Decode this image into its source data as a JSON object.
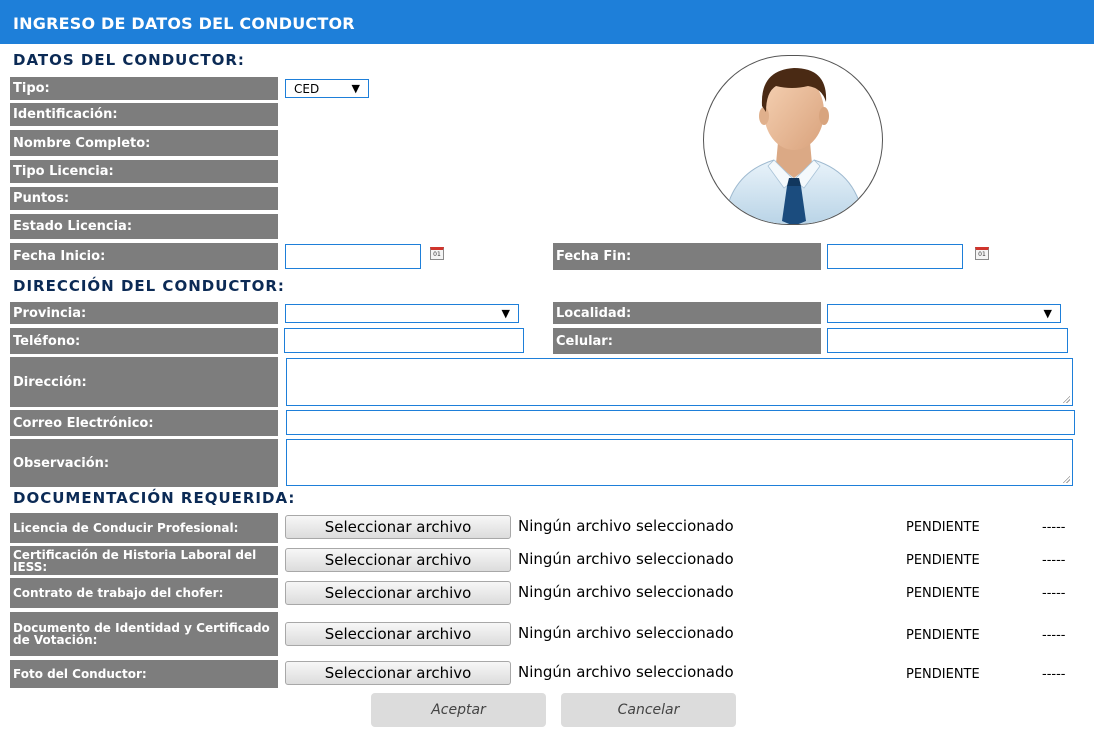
{
  "header": {
    "title": "INGRESO DE DATOS DEL CONDUCTOR"
  },
  "conductor": {
    "section_title": "DATOS DEL CONDUCTOR:",
    "tipo_label": "Tipo:",
    "tipo_value": "CED",
    "identificacion_label": "Identificación:",
    "nombre_label": "Nombre Completo:",
    "tipo_licencia_label": "Tipo Licencia:",
    "puntos_label": "Puntos:",
    "estado_licencia_label": "Estado Licencia:",
    "fecha_inicio_label": "Fecha Inicio:",
    "fecha_fin_label": "Fecha Fin:",
    "calendar_text": "01"
  },
  "direccion": {
    "section_title": "DIRECCIÓN DEL CONDUCTOR:",
    "provincia_label": "Provincia:",
    "localidad_label": "Localidad:",
    "telefono_label": "Teléfono:",
    "celular_label": "Celular:",
    "direccion_label": "Dirección:",
    "correo_label": "Correo Electrónico:",
    "observacion_label": "Observación:"
  },
  "documentacion": {
    "section_title": "DOCUMENTACIÓN REQUERIDA:",
    "button_label": "Seleccionar archivo",
    "no_file_text": "Ningún archivo seleccionado",
    "items": [
      {
        "label": "Licencia de Conducir Profesional:",
        "status": "PENDIENTE",
        "extra": "-----"
      },
      {
        "label": "Certificación de Historia Laboral del IESS:",
        "status": "PENDIENTE",
        "extra": "-----"
      },
      {
        "label": "Contrato de trabajo del chofer:",
        "status": "PENDIENTE",
        "extra": "-----"
      },
      {
        "label": "Documento de Identidad y Certificado de Votación:",
        "status": "PENDIENTE",
        "extra": "-----"
      },
      {
        "label": "Foto del Conductor:",
        "status": "PENDIENTE",
        "extra": "-----"
      }
    ]
  },
  "actions": {
    "accept_label": "Aceptar",
    "cancel_label": "Cancelar"
  },
  "colors": {
    "header_bg": "#1e7fd9",
    "label_bg": "#7d7d7d",
    "section_title": "#0b2a55",
    "input_border": "#1e7fd9"
  }
}
